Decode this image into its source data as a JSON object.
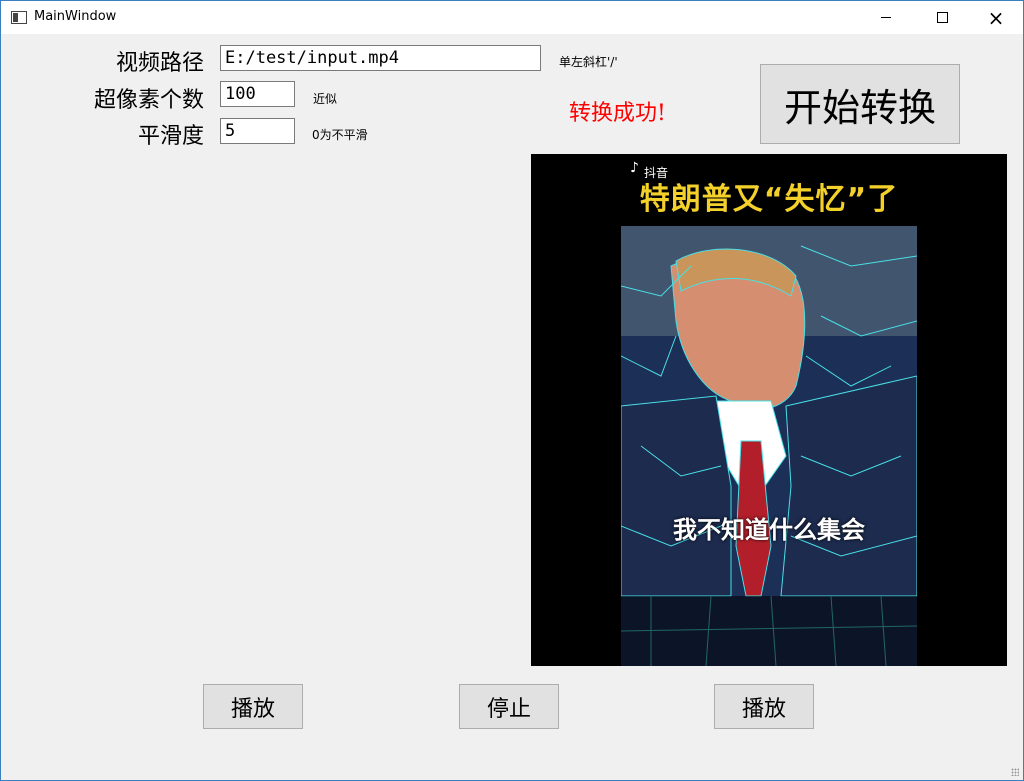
{
  "window": {
    "title": "MainWindow",
    "minimize_glyph": "minimize-icon",
    "maximize_glyph": "maximize-icon",
    "close_glyph": "×"
  },
  "form": {
    "video_path_label": "视频路径",
    "video_path_value": "E:/test/input.mp4",
    "video_path_hint": "单左斜杠'/'",
    "superpixel_label": "超像素个数",
    "superpixel_value": "100",
    "superpixel_hint": "近似",
    "smooth_label": "平滑度",
    "smooth_value": "5",
    "smooth_hint": "0为不平滑"
  },
  "status": {
    "message": "转换成功!",
    "color": "#ff0000"
  },
  "actions": {
    "convert_label": "开始转换",
    "play_left_label": "播放",
    "stop_label": "停止",
    "play_right_label": "播放"
  },
  "video": {
    "top_caption": "特朗普又“失忆”了",
    "bottom_caption": "我不知道什么集会",
    "watermark": "抖音"
  }
}
